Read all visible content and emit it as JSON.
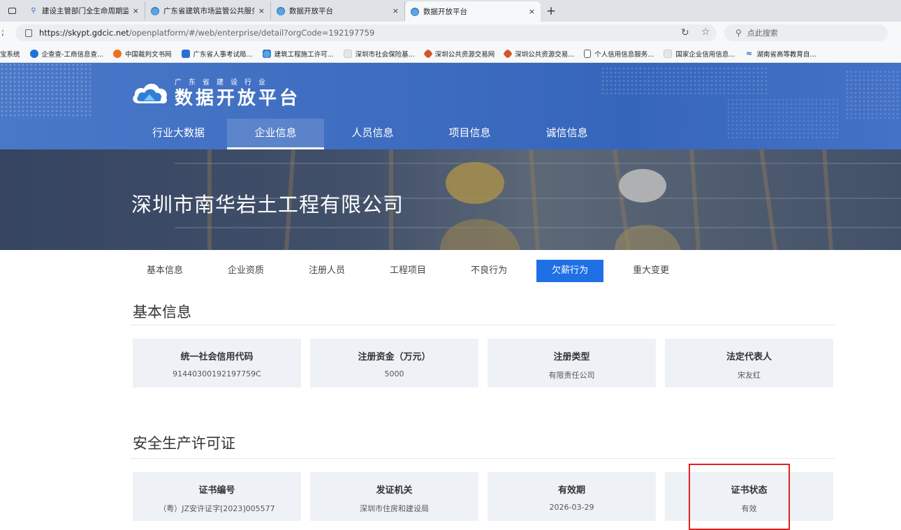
{
  "browser": {
    "tabs": [
      {
        "title": "建设主管部门全生命周期监管平台",
        "active": false
      },
      {
        "title": "广东省建筑市场监管公共服务平台",
        "active": false
      },
      {
        "title": "数据开放平台",
        "active": false
      },
      {
        "title": "数据开放平台",
        "active": true
      }
    ],
    "close_glyph": "×",
    "new_tab_glyph": "+",
    "url_host": "https://skypt.gdcic.net",
    "url_path": "/openplatform/#/web/enterprise/detail?orgCode=192197759",
    "back_fragment": ";",
    "search_placeholder": "点此搜索",
    "bookmarks": [
      {
        "label": "宝系统"
      },
      {
        "label": "企查查-工商信息查..."
      },
      {
        "label": "中国裁判文书网"
      },
      {
        "label": "广东省人事考试局..."
      },
      {
        "label": "建筑工程施工许可..."
      },
      {
        "label": "深圳市社会保险基..."
      },
      {
        "label": "深圳公共资源交易网"
      },
      {
        "label": "深圳公共资源交易..."
      },
      {
        "label": "个人信用信息服务..."
      },
      {
        "label": "国家企业信用信息..."
      },
      {
        "label": "湖南省高等教育自..."
      }
    ]
  },
  "site": {
    "logo_sub": "广东省建设行业",
    "logo_main": "数据开放平台",
    "nav": [
      "行业大数据",
      "企业信息",
      "人员信息",
      "项目信息",
      "诚信信息"
    ],
    "nav_active_index": 1,
    "company_name": "深圳市南华岩土工程有限公司",
    "subtabs": [
      "基本信息",
      "企业资质",
      "注册人员",
      "工程项目",
      "不良行为",
      "欠薪行为",
      "重大变更"
    ],
    "subtab_active_index": 5
  },
  "basic_info": {
    "title": "基本信息",
    "cards": [
      {
        "label": "统一社会信用代码",
        "value": "91440300192197759C"
      },
      {
        "label": "注册资金（万元）",
        "value": "5000"
      },
      {
        "label": "注册类型",
        "value": "有限责任公司"
      },
      {
        "label": "法定代表人",
        "value": "宋友红"
      }
    ]
  },
  "safety_license": {
    "title": "安全生产许可证",
    "cards": [
      {
        "label": "证书编号",
        "value": "（粤）JZ安许证字[2023]005577"
      },
      {
        "label": "发证机关",
        "value": "深圳市住房和建设局"
      },
      {
        "label": "有效期",
        "value": "2026-03-29"
      },
      {
        "label": "证书状态",
        "value": "有效"
      }
    ]
  },
  "colors": {
    "header_blue": "#3d6cc0",
    "active_subtab": "#1f6fe5",
    "card_bg": "#eef2f7",
    "highlight_red": "#e02020"
  }
}
